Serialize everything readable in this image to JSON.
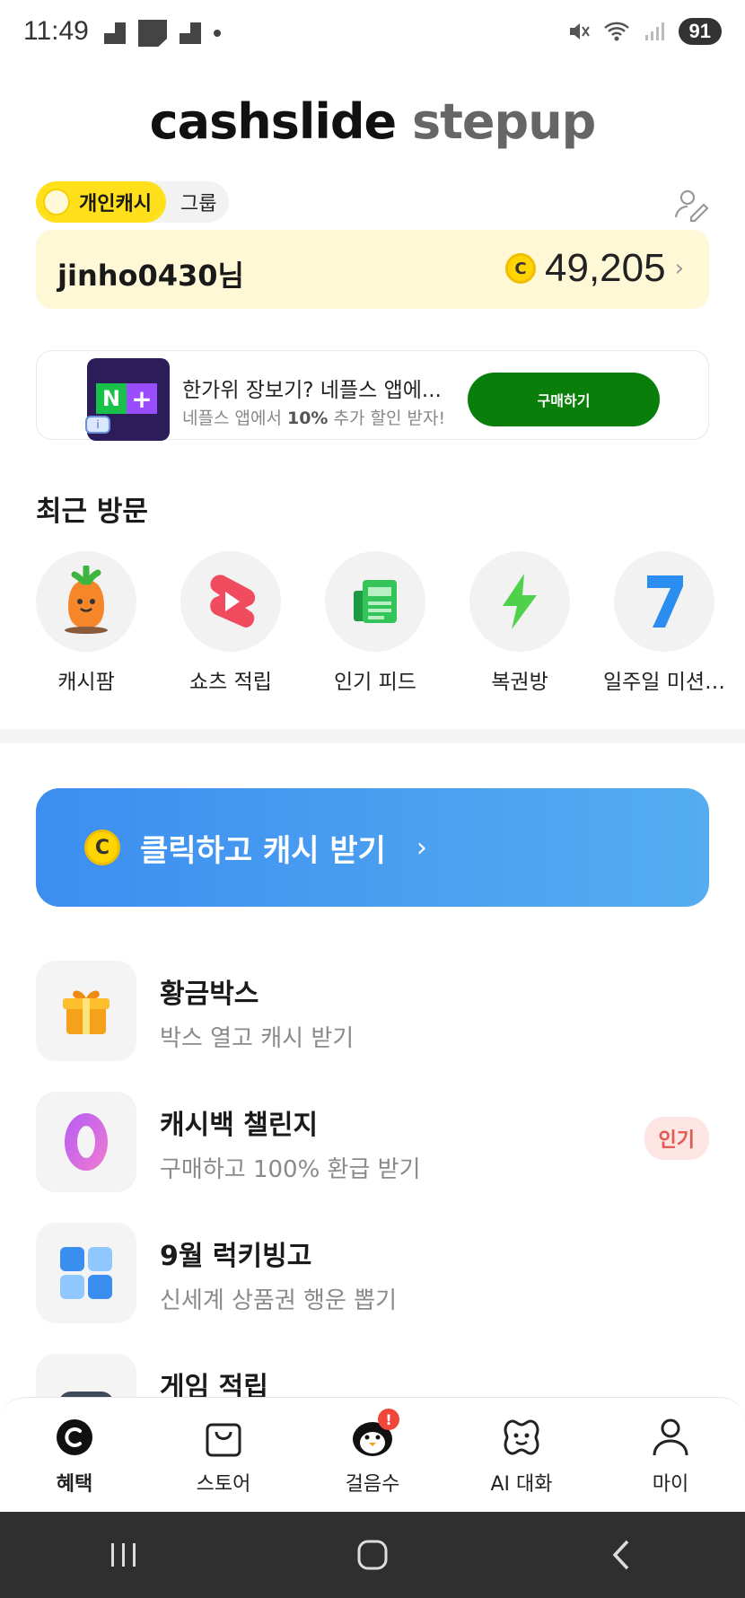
{
  "status_bar": {
    "time": "11:49",
    "battery": "91"
  },
  "logo": {
    "part1": "cashslide",
    "part2": "stepup"
  },
  "toggle": {
    "personal": "개인캐시",
    "group": "그룹"
  },
  "balance": {
    "username": "jinho0430님",
    "coin_symbol": "C",
    "amount": "49,205",
    "chevron": "›"
  },
  "ad": {
    "title": "한가위 장보기? 네플스 앱에...",
    "subtitle_prefix": "네플스 앱에서 ",
    "subtitle_bold": "10%",
    "subtitle_suffix": " 추가 할인 받자!",
    "button": "구매하기",
    "info": "i",
    "thumb_n": "N",
    "thumb_plus": "+"
  },
  "recent": {
    "title": "최근 방문",
    "items": [
      {
        "label": "캐시팜",
        "icon": "carrot-icon"
      },
      {
        "label": "쇼츠 적립",
        "icon": "shorts-play-icon"
      },
      {
        "label": "인기 피드",
        "icon": "newspaper-icon"
      },
      {
        "label": "복권방",
        "icon": "lightning-icon"
      },
      {
        "label": "일주일 미션…",
        "icon": "seven-icon"
      }
    ]
  },
  "banner": {
    "coin_symbol": "C",
    "text": "클릭하고 캐시 받기",
    "chevron": "›"
  },
  "benefits": [
    {
      "title": "황금박스",
      "subtitle": "박스 열고 캐시 받기",
      "icon": "gift-box-icon"
    },
    {
      "title": "캐시백 챌린지",
      "subtitle": "구매하고 100% 환급 받기",
      "badge": "인기",
      "icon": "zero-icon"
    },
    {
      "title": "9월 럭키빙고",
      "subtitle": "신세계 상품권 행운 뽑기",
      "icon": "bingo-grid-icon"
    },
    {
      "title": "게임 적립",
      "subtitle": "",
      "icon": "gamepad-icon"
    }
  ],
  "bottom_nav": {
    "items": [
      {
        "label": "혜택",
        "icon": "cash-coin-icon",
        "active": true
      },
      {
        "label": "스토어",
        "icon": "shopping-bag-icon"
      },
      {
        "label": "걸음수",
        "icon": "penguin-icon",
        "alert": "!"
      },
      {
        "label": "AI 대화",
        "icon": "ai-face-icon"
      },
      {
        "label": "마이",
        "icon": "person-icon"
      }
    ]
  },
  "colors": {
    "yellow": "#ffe01b",
    "cream": "#fff8d6",
    "banner_blue": "#3d8ef0",
    "ad_green": "#0a7e0a",
    "badge_red": "#e05a52"
  }
}
